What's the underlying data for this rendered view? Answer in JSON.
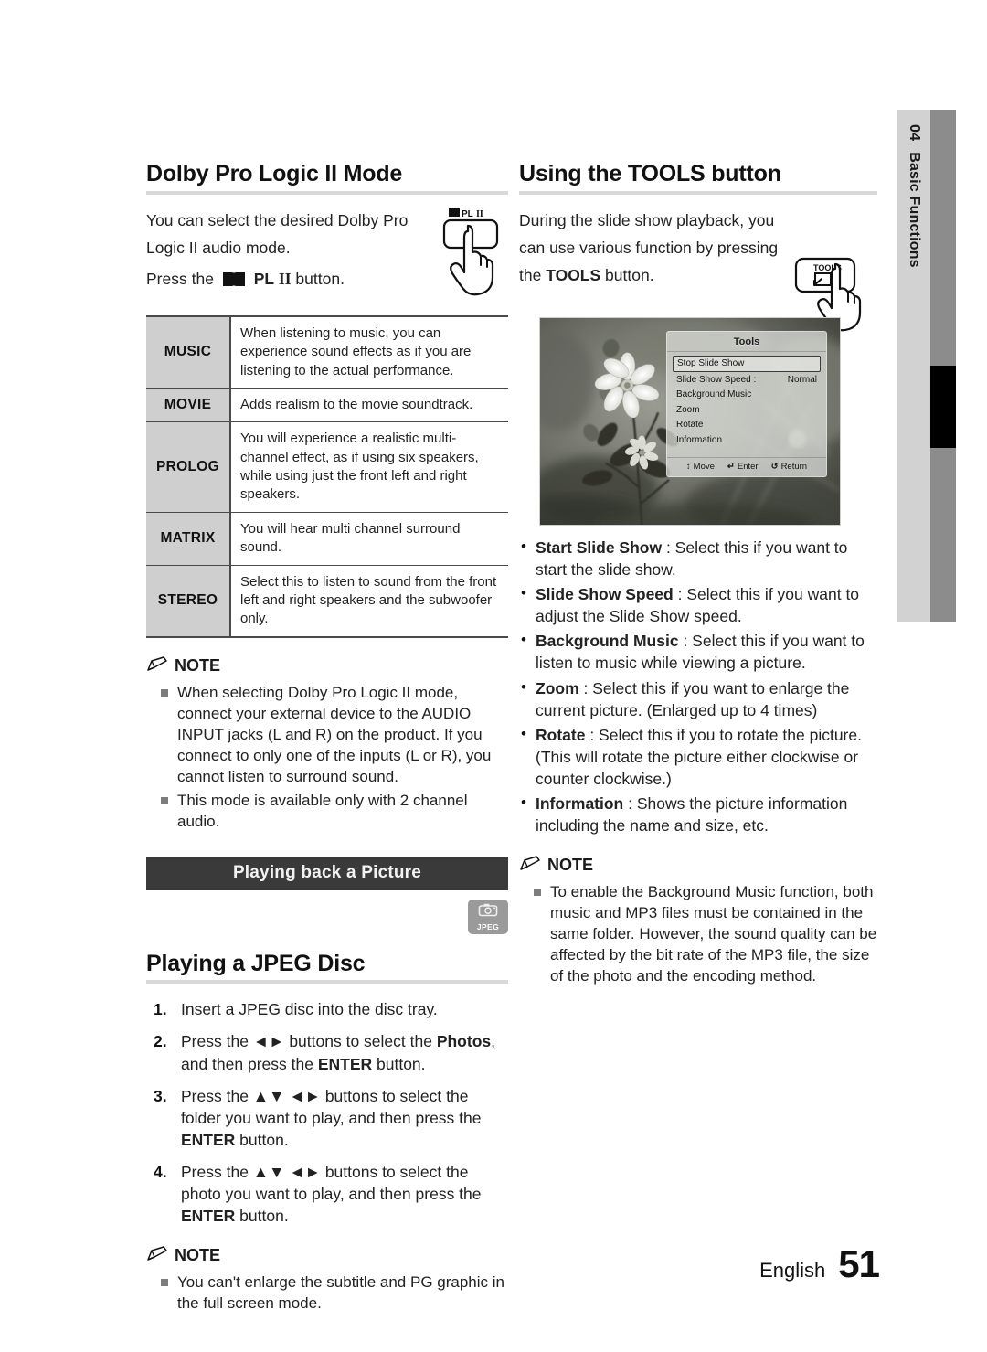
{
  "side_tab": {
    "number": "04",
    "label": "Basic Functions"
  },
  "footer": {
    "language": "English",
    "page": "51"
  },
  "left": {
    "heading": "Dolby Pro Logic II Mode",
    "intro_line1": "You can select the desired Dolby Pro",
    "intro_line2": "Logic II audio mode.",
    "press_prefix": "Press the",
    "press_button": "PL II",
    "press_suffix": "button.",
    "button_icon_label": "PL II",
    "table": {
      "rows": [
        {
          "name": "MUSIC",
          "desc": "When listening to music, you can experience sound effects as if you are listening to the actual performance."
        },
        {
          "name": "MOVIE",
          "desc": "Adds realism to the movie soundtrack."
        },
        {
          "name": "PROLOG",
          "desc": "You will experience a realistic multi-channel effect, as if using six speakers, while using just the front left and right speakers."
        },
        {
          "name": "MATRIX",
          "desc": "You will hear multi channel surround sound."
        },
        {
          "name": "STEREO",
          "desc": "Select this to listen to sound from the front left and right speakers and the subwoofer only."
        }
      ]
    },
    "note_title": "NOTE",
    "notes": [
      "When selecting Dolby Pro Logic II mode, connect your external device to the AUDIO INPUT jacks (L and R) on the product. If you connect to only one of the inputs (L or R), you cannot listen to surround sound.",
      "This mode is available only with 2 channel audio."
    ],
    "banner": "Playing back a Picture",
    "badge_label": "JPEG",
    "jpeg_heading": "Playing a JPEG Disc",
    "steps": [
      {
        "num": "1.",
        "text": "Insert a JPEG disc into the disc tray."
      },
      {
        "num": "2.",
        "text": "Press the ◄► buttons to select the Photos, and then press the ENTER button."
      },
      {
        "num": "3.",
        "text": "Press the ▲▼ ◄► buttons to select the folder you want to play, and then press the ENTER button."
      },
      {
        "num": "4.",
        "text": "Press the ▲▼ ◄► buttons to select the photo you want to play, and then press the ENTER button."
      }
    ],
    "note2_title": "NOTE",
    "notes2": [
      "You can't enlarge the subtitle and PG graphic in the full screen mode."
    ]
  },
  "right": {
    "heading": "Using the TOOLS button",
    "intro_line1": "During the slide show playback, you",
    "intro_line2": "can use various function by pressing",
    "intro_line3_prefix": "the",
    "intro_line3_bold": "TOOLS",
    "intro_line3_suffix": "button.",
    "button_icon_label": "TOOLS",
    "tv": {
      "panel_title": "Tools",
      "items": [
        {
          "label": "Stop Slide Show",
          "value": "",
          "selected": true
        },
        {
          "label": "Slide Show Speed :",
          "value": "Normal",
          "selected": false
        },
        {
          "label": "Background Music",
          "value": "",
          "selected": false
        },
        {
          "label": "Zoom",
          "value": "",
          "selected": false
        },
        {
          "label": "Rotate",
          "value": "",
          "selected": false
        },
        {
          "label": "Information",
          "value": "",
          "selected": false
        }
      ],
      "footer": [
        {
          "icon": "↕",
          "label": "Move"
        },
        {
          "icon": "↵",
          "label": "Enter"
        },
        {
          "icon": "↺",
          "label": "Return"
        }
      ]
    },
    "tools_list": [
      {
        "term": "Start Slide Show",
        "desc": ": Select this if you want to start the slide show."
      },
      {
        "term": "Slide Show Speed",
        "desc": ": Select this if you want to adjust the Slide Show speed."
      },
      {
        "term": "Background Music",
        "desc": ": Select this if you want to listen to music while viewing a picture."
      },
      {
        "term": "Zoom",
        "desc": ": Select this if you want to enlarge the current picture. (Enlarged up to 4 times)"
      },
      {
        "term": "Rotate",
        "desc": ": Select this if you to rotate the picture. (This will rotate the picture either clockwise or counter clockwise.)"
      },
      {
        "term": "Information",
        "desc": ": Shows the picture information including the name and size, etc."
      }
    ],
    "note_title": "NOTE",
    "notes": [
      "To enable the Background Music function, both music and MP3 files must be contained in the same folder. However, the sound quality can be affected by the bit rate of the MP3 file, the size of the photo and the encoding method."
    ]
  },
  "colors": {
    "banner_bg": "#3a3a3a",
    "table_header_bg": "#cfcfcf",
    "rule": "#d9d9d9",
    "side_tab_bg": "#d2d2d2",
    "side_bar_bg": "#8c8c8c"
  }
}
